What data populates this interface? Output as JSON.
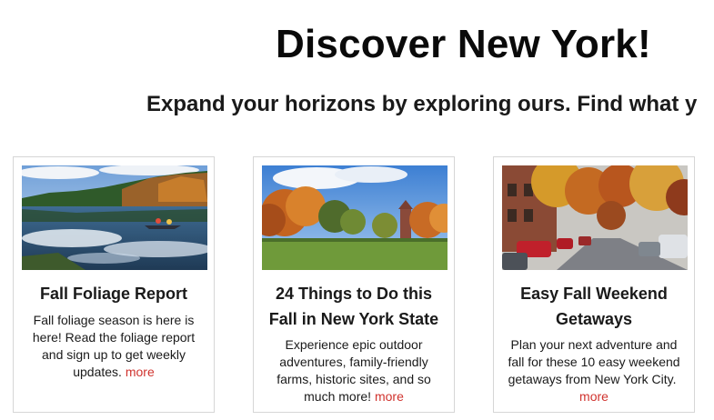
{
  "header": {
    "title": "Discover New York!",
    "subtitle": "Expand your horizons by exploring ours. Find what y"
  },
  "cards": [
    {
      "image": "lake-kayak-fall-photo",
      "title": "Fall Foliage Report",
      "description": "Fall foliage season is here is here! Read the foliage report and sign up to get weekly updates.",
      "more": "more"
    },
    {
      "image": "campus-lawn-fall-photo",
      "title": "24 Things to Do this Fall in New York State",
      "description": "Experience epic outdoor adventures, family-friendly farms, historic sites, and so much more!",
      "more": "more"
    },
    {
      "image": "town-street-fall-photo",
      "title": "Easy Fall Weekend Getaways",
      "description": "Plan your next adventure and fall for these 10 easy weekend getaways from New York City.",
      "more": "more"
    }
  ],
  "colors": {
    "link": "#d0332e",
    "border": "#d6d6d6"
  }
}
